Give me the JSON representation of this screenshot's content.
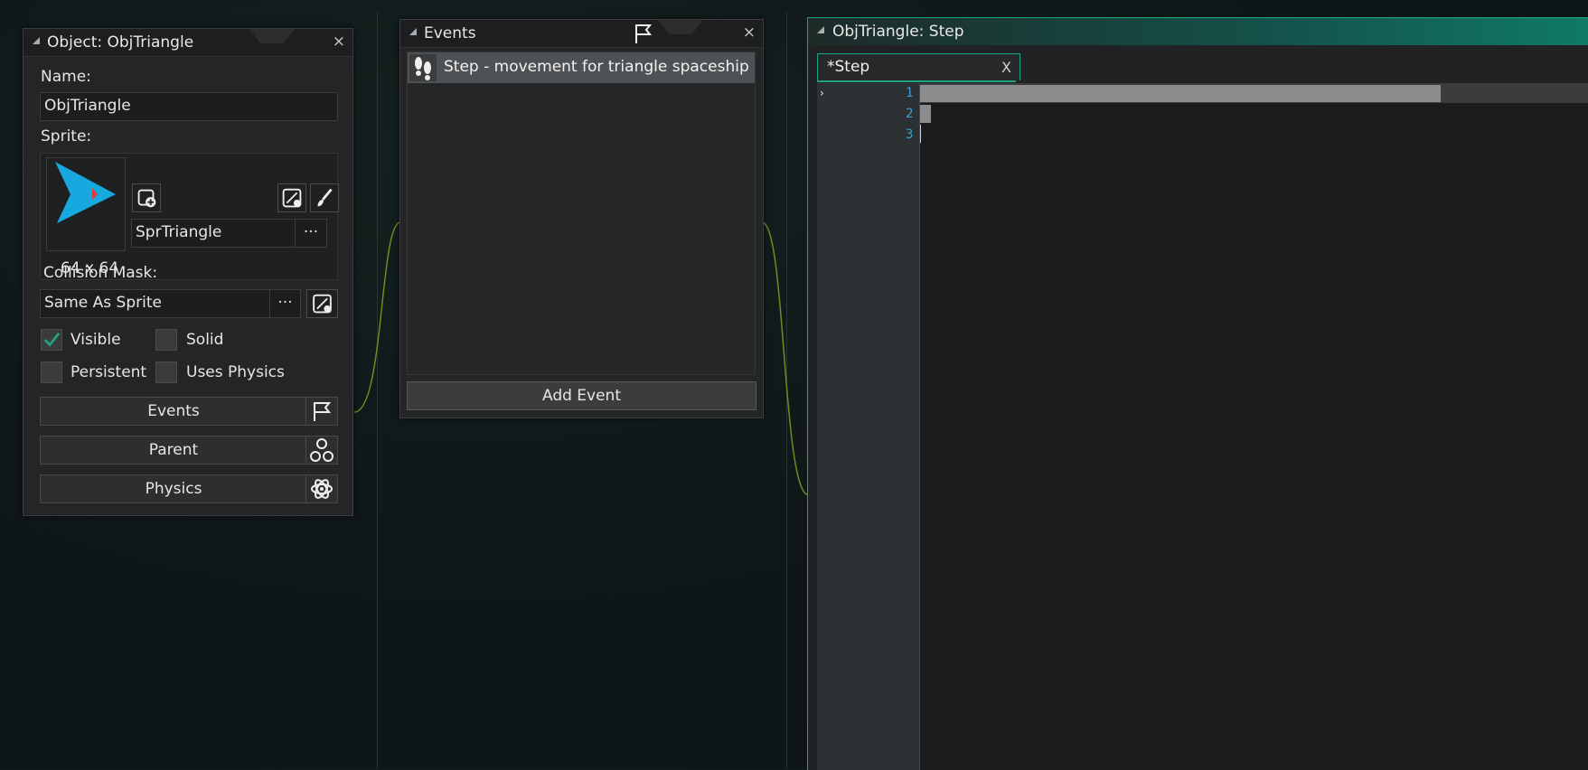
{
  "object_panel": {
    "title": "Object: ObjTriangle",
    "close": "×",
    "name_label": "Name:",
    "name_value": "ObjTriangle",
    "sprite_label": "Sprite:",
    "sprite_name": "SprTriangle",
    "sprite_size": "64 x 64",
    "browse": "···",
    "collision_label": "Collision Mask:",
    "collision_value": "Same As Sprite",
    "checkboxes": {
      "visible": {
        "label": "Visible",
        "checked": true
      },
      "solid": {
        "label": "Solid",
        "checked": false
      },
      "persistent": {
        "label": "Persistent",
        "checked": false
      },
      "uses_physics": {
        "label": "Uses Physics",
        "checked": false
      }
    },
    "buttons": {
      "events": "Events",
      "parent": "Parent",
      "physics": "Physics"
    }
  },
  "events_panel": {
    "title": "Events",
    "close": "×",
    "items": [
      {
        "label": "Step - movement for triangle spaceship",
        "icon": "footsteps-icon",
        "selected": true
      }
    ],
    "add_event": "Add Event"
  },
  "code_panel": {
    "title": "ObjTriangle: Step",
    "tab_label": "*Step",
    "tab_close": "X",
    "line_numbers": [
      "1",
      "2",
      "3"
    ]
  },
  "colors": {
    "accent_green": "#1fa37c",
    "sprite_blue": "#18a8e0",
    "line_number": "#3f9fd0",
    "selection": "#8a8c8e"
  }
}
